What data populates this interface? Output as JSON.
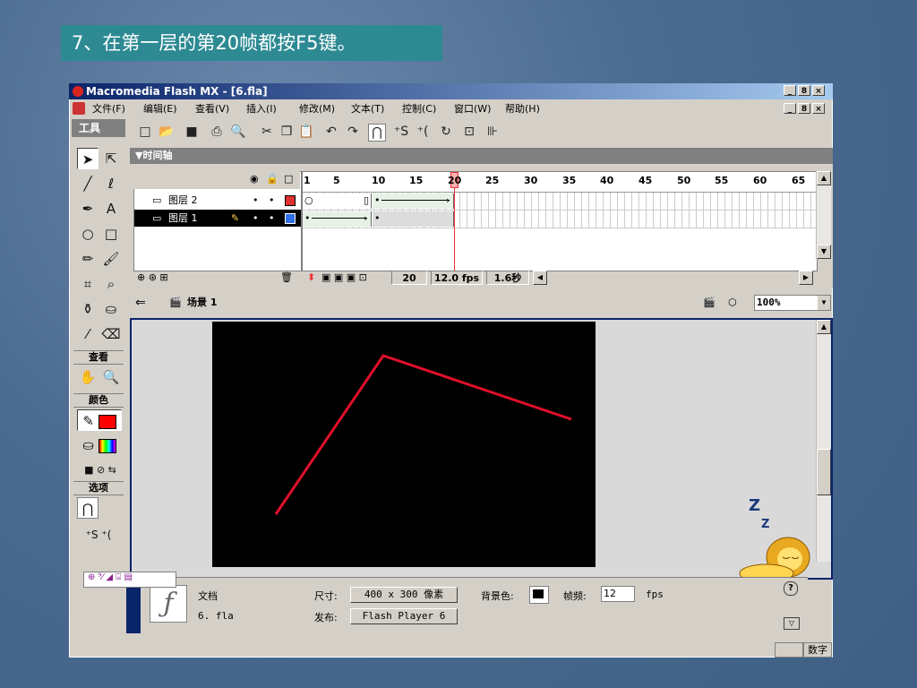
{
  "caption": "7、在第一层的第20帧都按F5键。",
  "window": {
    "title": "Macromedia Flash MX - [6.fla]",
    "buttons": [
      "_",
      "8",
      "×"
    ]
  },
  "menu": [
    "文件(F)",
    "编辑(E)",
    "查看(V)",
    "插入(I)",
    "修改(M)",
    "文本(T)",
    "控制(C)",
    "窗口(W)",
    "帮助(H)"
  ],
  "tools_panel": {
    "title": "工具",
    "view_label": "查看",
    "colors_label": "颜色",
    "options_label": "选项",
    "stroke_color": "#ff0000",
    "fill_color": "#ff0000"
  },
  "timeline": {
    "title": "▼时间轴",
    "ruler_numbers": [
      "1",
      "5",
      "10",
      "15",
      "20",
      "25",
      "30",
      "35",
      "40",
      "45",
      "50",
      "55",
      "60",
      "65"
    ],
    "layers": [
      {
        "name": "图层 2",
        "color": "#e03030",
        "selected": false
      },
      {
        "name": "图层 1",
        "color": "#3070e8",
        "selected": true
      }
    ],
    "current_frame": "20",
    "fps": "12.0 fps",
    "time": "1.6秒"
  },
  "scene": {
    "name": "场景 1",
    "zoom": "100%"
  },
  "properties": {
    "doc_label": "文档",
    "file_name": "6. fla",
    "size_label": "尺寸:",
    "size_value": "400 x 300 像素",
    "bg_label": "背景色:",
    "framerate_label": "帧频:",
    "framerate_value": "12",
    "fps_unit": "fps",
    "publish_label": "发布:",
    "publish_value": "Flash Player 6"
  },
  "lion": {
    "z1": "Z",
    "z2": "Z"
  },
  "status": {
    "numlock": "数字"
  }
}
